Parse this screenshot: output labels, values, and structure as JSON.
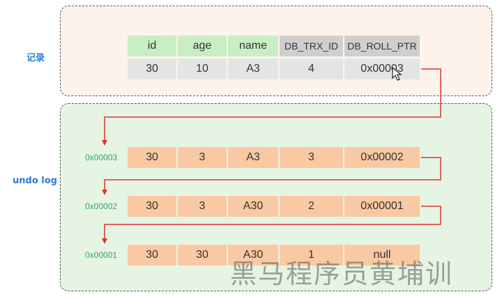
{
  "labels": {
    "record": "记录",
    "undo_log": "undo log"
  },
  "record_table": {
    "headers": [
      "id",
      "age",
      "name",
      "DB_TRX_ID",
      "DB_ROLL_PTR"
    ],
    "row": [
      "30",
      "10",
      "A3",
      "4",
      "0x00003"
    ]
  },
  "undo_entries": [
    {
      "address": "0x00003",
      "cells": [
        "30",
        "3",
        "A3",
        "3",
        "0x00002"
      ]
    },
    {
      "address": "0x00002",
      "cells": [
        "30",
        "3",
        "A30",
        "2",
        "0x00001"
      ]
    },
    {
      "address": "0x00001",
      "cells": [
        "30",
        "30",
        "A30",
        "1",
        "null"
      ]
    }
  ],
  "watermark": "黑马程序员黄埔训",
  "colors": {
    "arrow": "#e0332b",
    "header_green": "#c9eec4",
    "header_gray": "#cfcfcf",
    "undo_cell": "#f9c9a3",
    "address_text": "#3aa65a",
    "label_text": "#2a7fd6"
  }
}
